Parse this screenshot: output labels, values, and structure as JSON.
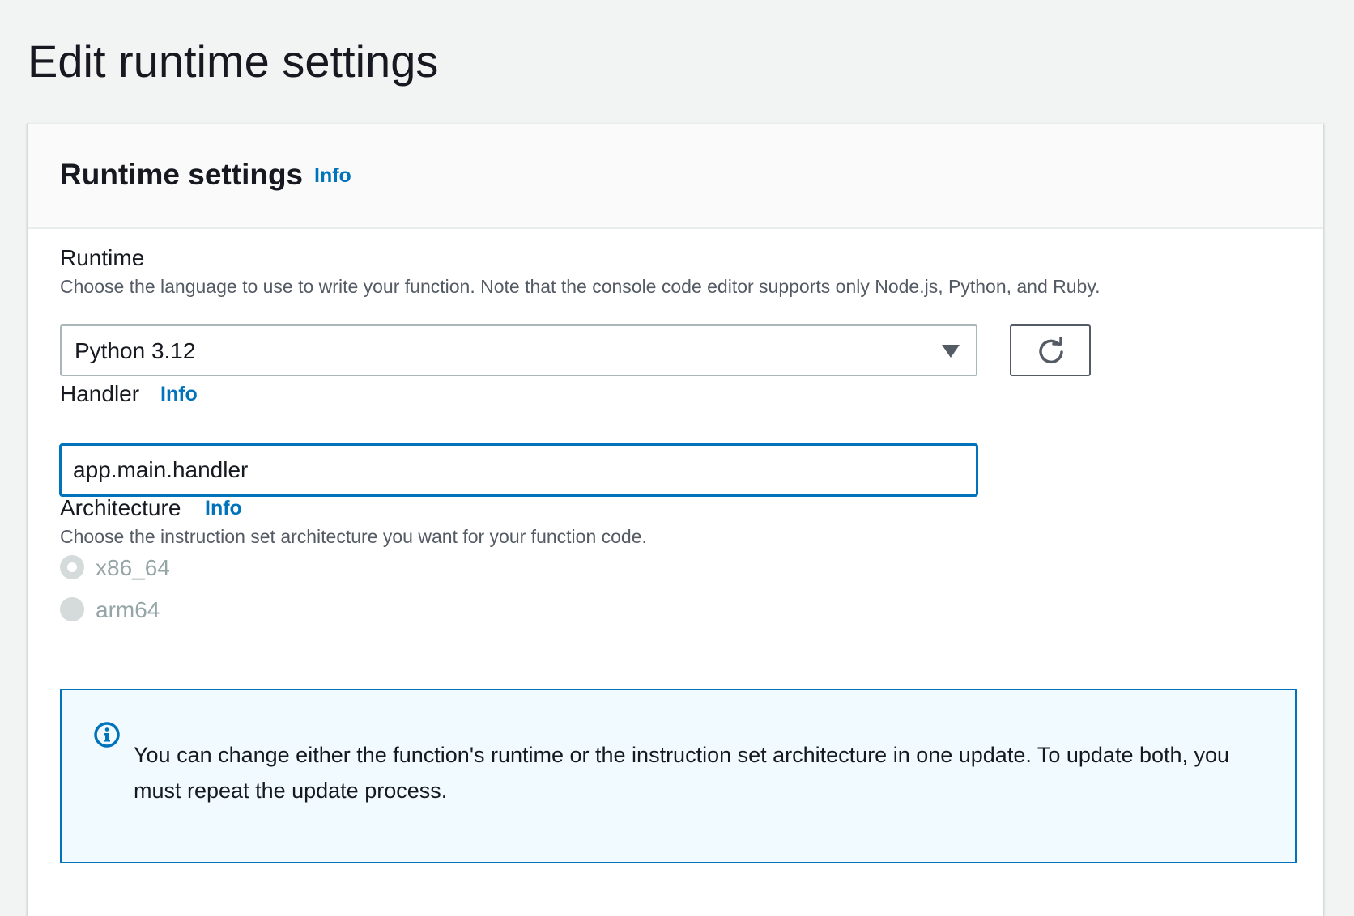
{
  "page": {
    "title": "Edit runtime settings"
  },
  "panel": {
    "title": "Runtime settings",
    "info_label": "Info"
  },
  "runtime": {
    "label": "Runtime",
    "description": "Choose the language to use to write your function. Note that the console code editor supports only Node.js, Python, and Ruby.",
    "selected": "Python 3.12"
  },
  "handler": {
    "label": "Handler",
    "info_label": "Info",
    "value": "app.main.handler"
  },
  "architecture": {
    "label": "Architecture",
    "info_label": "Info",
    "description": "Choose the instruction set architecture you want for your function code.",
    "options": [
      {
        "label": "x86_64",
        "checked": true,
        "disabled": true
      },
      {
        "label": "arm64",
        "checked": false,
        "disabled": true
      }
    ]
  },
  "alert": {
    "icon": "info-circle-icon",
    "text": "You can change either the function's runtime or the instruction set architecture in one update. To update both, you must repeat the update process."
  },
  "colors": {
    "link": "#0073bb",
    "focus_border": "#0073bb",
    "alert_background": "#f1faff",
    "page_background": "#f2f3f3"
  }
}
